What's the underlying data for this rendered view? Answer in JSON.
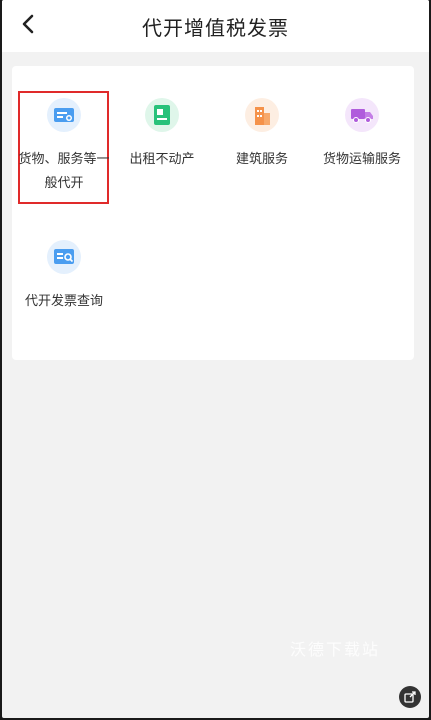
{
  "header": {
    "title": "代开增值税发票",
    "back_icon": "chevron-left-icon"
  },
  "services": [
    {
      "label": "货物、服务等一般代开",
      "icon": "invoice-card-icon",
      "color": "#4a9df0"
    },
    {
      "label": "出租不动产",
      "icon": "document-green-icon",
      "color": "#27c27a"
    },
    {
      "label": "建筑服务",
      "icon": "building-icon",
      "color": "#f5924a"
    },
    {
      "label": "货物运输服务",
      "icon": "truck-icon",
      "color": "#b05cdc"
    },
    {
      "label": "代开发票查询",
      "icon": "invoice-search-icon",
      "color": "#4a9df0"
    }
  ],
  "watermark": "沃德下载站",
  "float_button_icon": "share-icon"
}
